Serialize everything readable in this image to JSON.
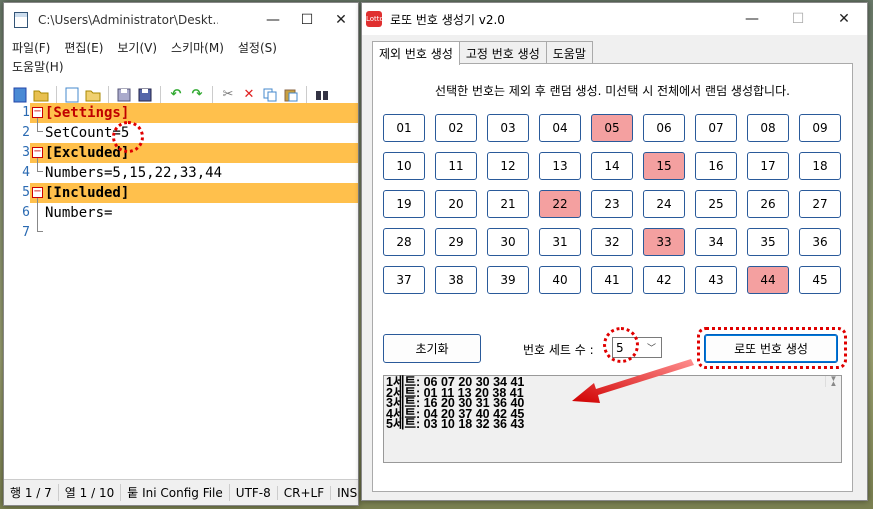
{
  "notepad": {
    "title": "C:\\Users\\Administrator\\Deskt...",
    "window_buttons": [
      "—",
      "☐",
      "✕"
    ],
    "menu": [
      "파일(F)",
      "편집(E)",
      "보기(V)",
      "스키마(M)",
      "설정(S)",
      "도움말(H)"
    ],
    "toolbar_icons": [
      "new-icon",
      "open-icon",
      "blank-icon",
      "open-file-icon",
      "save-icon",
      "save-all-icon",
      "undo-icon",
      "redo-icon",
      "cut-icon",
      "delete-icon",
      "copy-icon",
      "paste-icon",
      "find-icon"
    ],
    "line_numbers": [
      "1",
      "2",
      "3",
      "4",
      "5",
      "6",
      "7"
    ],
    "lines": [
      "[Settings]",
      "SetCount=5",
      "[Excluded]",
      "Numbers=5,15,22,33,44",
      "[Included]",
      "Numbers=",
      ""
    ],
    "status": [
      "행 1 / 7",
      "열 1 / 10",
      "퉅 Ini Config File",
      "UTF-8",
      "CR+LF",
      "INS"
    ]
  },
  "lotto": {
    "title": "로또 번호 생성기 v2.0",
    "icon_text": "Lotto",
    "window_buttons": [
      "—",
      "☐",
      "✕"
    ],
    "tabs": [
      "제외 번호 생성",
      "고정 번호 생성",
      "도움말"
    ],
    "description": "선택한 번호는 제외 후 랜덤 생성. 미선택 시 전체에서 랜덤 생성합니다.",
    "numbers": [
      "01",
      "02",
      "03",
      "04",
      "05",
      "06",
      "07",
      "08",
      "09",
      "10",
      "11",
      "12",
      "13",
      "14",
      "15",
      "16",
      "17",
      "18",
      "19",
      "20",
      "21",
      "22",
      "23",
      "24",
      "25",
      "26",
      "27",
      "28",
      "29",
      "30",
      "31",
      "32",
      "33",
      "34",
      "35",
      "36",
      "37",
      "38",
      "39",
      "40",
      "41",
      "42",
      "43",
      "44",
      "45"
    ],
    "selected": [
      "05",
      "15",
      "22",
      "33",
      "44"
    ],
    "selected_color": "#f4a0a0",
    "reset_label": "초기화",
    "set_count_label": "번호 세트 수 :",
    "set_count_value": "5",
    "generate_label": "로또 번호 생성",
    "output": [
      "1세트: 06 07 20 30 34 41",
      "2세트: 01 11 13 20 38 41",
      "3세트: 16 20 30 31 36 40",
      "4세트: 04 20 37 40 42 45",
      "5세트: 03 10 18 32 36 43"
    ]
  }
}
